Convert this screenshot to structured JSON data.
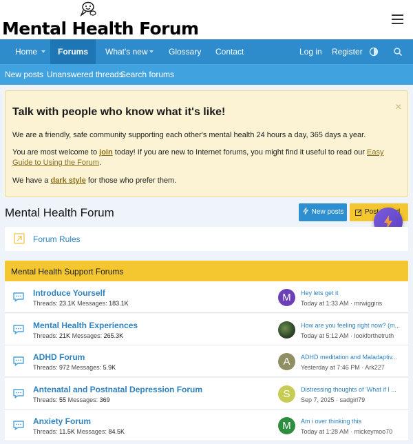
{
  "header": {
    "site_title": "Mental Health Forum",
    "logo_icon": "chat-bubbles-icon",
    "menu_icon": "hamburger-menu-icon"
  },
  "nav": {
    "home": "Home",
    "forums": "Forums",
    "whats_new": "What's new",
    "glossary": "Glossary",
    "contact": "Contact",
    "login": "Log in",
    "register": "Register",
    "style_icon": "style-toggle-icon",
    "search_icon": "search-icon"
  },
  "subnav": {
    "new_posts": "New posts",
    "unanswered": "Unanswered threads",
    "search_forums": "Search forums"
  },
  "notice": {
    "title": "Talk with people who know what it's like!",
    "close": "×",
    "line1": "We are a friendly, safe community supporting each other's mental health 24 hours a day, 365 days a year.",
    "line2_a": "You are most welcome to ",
    "join_link": "join",
    "line2_b": " today! If you are new to Internet forums, you might find it useful to read our ",
    "guide_link": "Easy Guide to Using the Forum",
    "line2_c": ".",
    "line3_a": "We have a ",
    "dark_link": "dark style",
    "line3_b": " for those who prefer them."
  },
  "main": {
    "page_title": "Mental Health Forum",
    "new_posts_btn": "New posts",
    "post_thread_btn": "Post thread"
  },
  "rules": {
    "label": "Forum Rules"
  },
  "category": {
    "title": "Mental Health Support Forums"
  },
  "forums": [
    {
      "name": "Introduce Yourself",
      "threads_label": "Threads:",
      "threads": "23.1K",
      "messages_label": "Messages:",
      "messages": "183.1K",
      "avatar_letter": "M",
      "avatar_color": "#6a3fb7",
      "last_title": "Hey lets get it",
      "last_time": "Today at 1:33 AM",
      "last_user": "mrwiggins"
    },
    {
      "name": "Mental Health Experiences",
      "threads_label": "Threads:",
      "threads": "21K",
      "messages_label": "Messages:",
      "messages": "265.3K",
      "avatar_letter": "",
      "avatar_color": "#3c5a32",
      "last_title": "How are you feeling right now? (m...",
      "last_time": "Today at 5:12 AM",
      "last_user": "lookforthetruth"
    },
    {
      "name": "ADHD Forum",
      "threads_label": "Threads:",
      "threads": "972",
      "messages_label": "Messages:",
      "messages": "5.9K",
      "avatar_letter": "A",
      "avatar_color": "#8f8f63",
      "last_title": "ADHD meditation and Maladaptiv...",
      "last_time": "Yesterday at 7:46 PM",
      "last_user": "Ark227"
    },
    {
      "name": "Antenatal and Postnatal Depression Forum",
      "threads_label": "Threads:",
      "threads": "55",
      "messages_label": "Messages:",
      "messages": "369",
      "avatar_letter": "S",
      "avatar_color": "#c7cc55",
      "last_title": "Distressing thoughts of 'What if I ...",
      "last_time": "Sep 7, 2025",
      "last_user": "sadgirl79"
    },
    {
      "name": "Anxiety Forum",
      "threads_label": "Threads:",
      "threads": "11.5K",
      "messages_label": "Messages:",
      "messages": "84.5K",
      "avatar_letter": "M",
      "avatar_color": "#2f8d3f",
      "last_title": "Am i over thinking this",
      "last_time": "Today at 1:28 AM",
      "last_user": "mickeymoo70"
    }
  ],
  "separator": "·"
}
